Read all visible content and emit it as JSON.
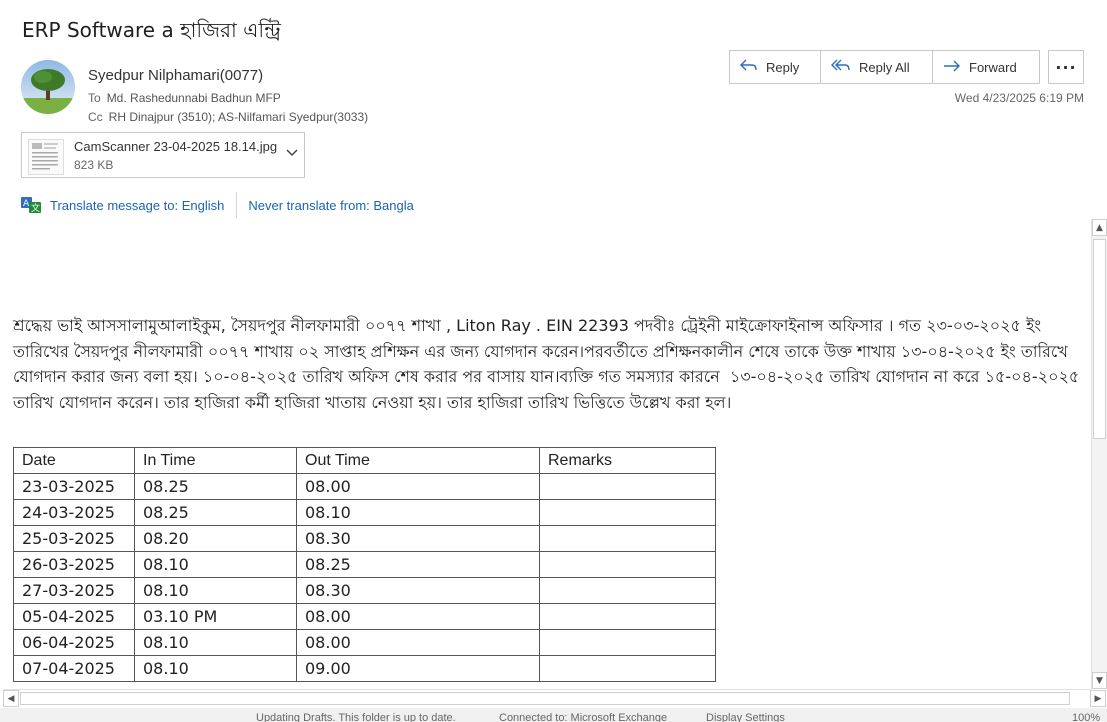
{
  "email": {
    "subject": "ERP Software a  হাজিরা এন্ট্রি",
    "sender": "Syedpur Nilphamari(0077)",
    "to_label": "To",
    "to": "Md. Rashedunnabi Badhun MFP",
    "cc_label": "Cc",
    "cc": "RH Dinajpur (3510); AS-Nilfamari Syedpur(3033)",
    "date": "Wed 4/23/2025 6:19 PM"
  },
  "actions": {
    "reply": "Reply",
    "reply_all": "Reply All",
    "forward": "Forward",
    "more": "···"
  },
  "attachment": {
    "name": "CamScanner 23-04-2025 18.14.jpg",
    "size": "823 KB"
  },
  "translate": {
    "translate_label": "Translate message to: English",
    "never_label": "Never translate from: Bangla"
  },
  "body": {
    "paragraph": "শ্রদ্ধেয় ভাই আসসালামুআলাইকুম, সৈয়দপুর নীলফামারী ০০৭৭ শাখা , Liton Ray . EIN 22393 পদবীঃ ট্রেইনী মাইক্রোফাইনান্স অফিসার । গত ২৩-০৩-২০২৫ ইং তারিখের সৈয়দপুর নীলফামারী ০০৭৭ শাখায় ০২ সাপ্তাহ প্রশিক্ষন এর জন্য যোগদান করেন।পরবর্তীতে প্রশিক্ষনকালীন শেষে তাকে উক্ত শাখায় ১৩-০৪-২০২৫ ইং তারিখে যোগদান করার জন্য বলা হয়। ১০-০৪-২০২৫ তারিখ অফিস শেষ করার পর বাসায় যান।ব্যক্তি গত সমস্যার কারনে  ১৩-০৪-২০২৫ তারিখ যোগদান না করে ১৫-০৪-২০২৫ তারিখ যোগদান করেন। তার হাজিরা কর্মী হাজিরা খাতায় নেওয়া হয়। তার হাজিরা তারিখ ভিত্তিতে উল্লেখ করা হল।"
  },
  "table": {
    "headers": [
      "Date",
      "In  Time",
      "Out  Time",
      "Remarks"
    ],
    "rows": [
      [
        "23-03-2025",
        "08.25",
        "08.00",
        ""
      ],
      [
        "24-03-2025",
        "08.25",
        "08.10",
        ""
      ],
      [
        "25-03-2025",
        "08.20",
        "08.30",
        ""
      ],
      [
        "26-03-2025",
        "08.10",
        "08.25",
        ""
      ],
      [
        "27-03-2025",
        "08.10",
        "08.30",
        ""
      ],
      [
        "05-04-2025",
        "03.10  PM",
        "08.00",
        ""
      ],
      [
        "06-04-2025",
        "08.10",
        "08.00",
        ""
      ],
      [
        "07-04-2025",
        "08.10",
        "09.00",
        ""
      ]
    ]
  },
  "status": {
    "left": "Updating Drafts.  This folder is up to date.",
    "connection": "Connected to: Microsoft Exchange",
    "display": "Display Settings",
    "zoom": "100%"
  },
  "icons": {
    "reply": "reply-icon",
    "reply_all": "reply-all-icon",
    "forward": "forward-icon",
    "translate": "translate-icon",
    "chevron": "chevron-down-icon"
  },
  "colors": {
    "accent": "#2f6ebd",
    "link": "#1a64b3"
  }
}
